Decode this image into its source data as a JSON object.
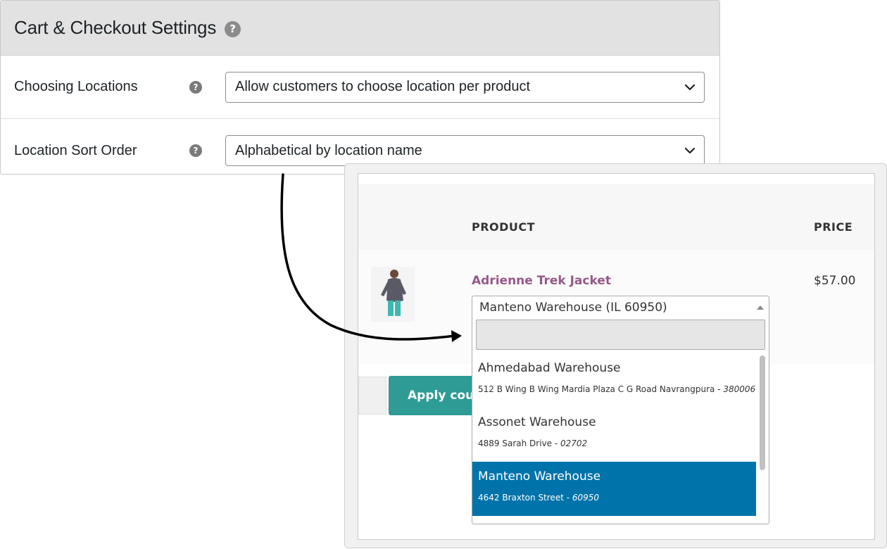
{
  "settings": {
    "title": "Cart & Checkout Settings",
    "help_glyph": "?",
    "rows": [
      {
        "label": "Choosing Locations",
        "value": "Allow customers to choose location per product"
      },
      {
        "label": "Location Sort Order",
        "value": "Alphabetical by location name"
      }
    ]
  },
  "cart": {
    "columns": {
      "product": "PRODUCT",
      "price": "PRICE"
    },
    "item": {
      "name": "Adrienne Trek Jacket",
      "price": "$57.00",
      "thumbnail_icon": "jacket-product-image"
    },
    "coupon_button": "Apply coupon",
    "location_select": {
      "selected": "Manteno Warehouse (IL 60950)",
      "search_value": "",
      "options": [
        {
          "name": "Ahmedabad Warehouse",
          "address": "512 B Wing B Wing Mardia Plaza C G Road Navrangpura - ",
          "zip": "380006",
          "active": false
        },
        {
          "name": "Assonet Warehouse",
          "address": "4889 Sarah Drive - ",
          "zip": "02702",
          "active": false
        },
        {
          "name": "Manteno Warehouse",
          "address": "4642 Braxton Street - ",
          "zip": "60950",
          "active": true
        }
      ]
    }
  },
  "colors": {
    "header_bg": "#e2e2e2",
    "product_link": "#96588a",
    "coupon_button": "#2e9b95",
    "highlight": "#0073aa"
  }
}
